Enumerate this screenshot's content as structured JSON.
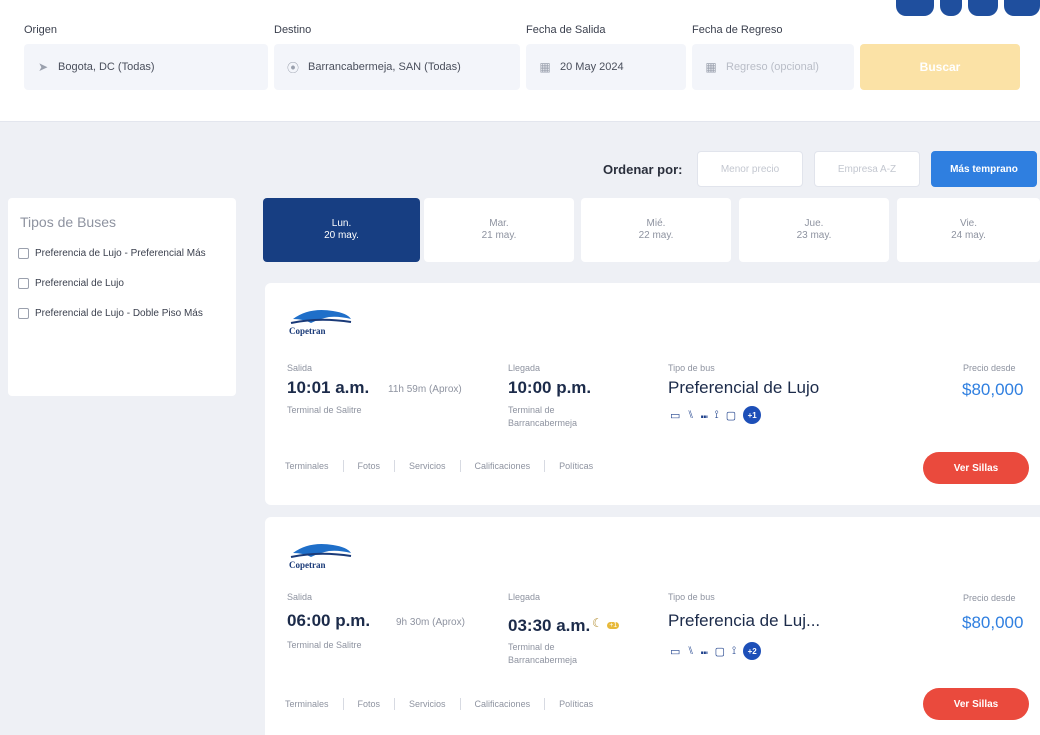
{
  "search": {
    "origin_label": "Origen",
    "origin_value": "Bogota, DC (Todas)",
    "destination_label": "Destino",
    "destination_value": "Barrancabermeja, SAN (Todas)",
    "departure_label": "Fecha de Salida",
    "departure_value": "20 May 2024",
    "return_label": "Fecha de Regreso",
    "return_placeholder": "Regreso (opcional)",
    "search_button": "Buscar"
  },
  "order": {
    "label": "Ordenar por:",
    "options": [
      "Menor precio",
      "Empresa A-Z",
      "Más temprano"
    ],
    "active": "Más temprano"
  },
  "filters": {
    "title": "Tipos de Buses",
    "items": [
      {
        "label": "Preferencia de Lujo - Preferencial Más"
      },
      {
        "label": "Preferencial de Lujo"
      },
      {
        "label": "Preferencial de Lujo - Doble Piso Más"
      }
    ]
  },
  "dates": [
    {
      "day": "Lun.",
      "date": "20 may.",
      "active": true
    },
    {
      "day": "Mar.",
      "date": "21 may.",
      "active": false
    },
    {
      "day": "Mié.",
      "date": "22 may.",
      "active": false
    },
    {
      "day": "Jue.",
      "date": "23 may.",
      "active": false
    },
    {
      "day": "Vie.",
      "date": "24 may.",
      "active": false
    }
  ],
  "trips": [
    {
      "company": "Copetran",
      "departure_label": "Salida",
      "departure_time": "10:01 a.m.",
      "duration": "11h 59m (Aprox)",
      "departure_terminal": "Terminal de Salitre",
      "arrival_label": "Llegada",
      "arrival_time": "10:00 p.m.",
      "arrival_terminal": "Terminal de Barrancabermeja",
      "bus_type_label": "Tipo de bus",
      "bus_type": "Preferencial de Lujo",
      "amenities_more": "+1",
      "price_label": "Precio desde",
      "price": "$80,000",
      "links": [
        "Terminales",
        "Fotos",
        "Servicios",
        "Calificaciones",
        "Políticas"
      ],
      "button": "Ver Sillas"
    },
    {
      "company": "Copetran",
      "departure_label": "Salida",
      "departure_time": "06:00 p.m.",
      "duration": "9h 30m (Aprox)",
      "departure_terminal": "Terminal de Salitre",
      "arrival_label": "Llegada",
      "arrival_time": "03:30 a.m.",
      "arrival_badge": "+1",
      "arrival_terminal": "Terminal de Barrancabermeja",
      "bus_type_label": "Tipo de bus",
      "bus_type": "Preferencia de Luj...",
      "amenities_more": "+2",
      "price_label": "Precio desde",
      "price": "$80,000",
      "links": [
        "Terminales",
        "Fotos",
        "Servicios",
        "Calificaciones",
        "Políticas"
      ],
      "button": "Ver Sillas"
    }
  ],
  "colors": {
    "primary": "#173e82",
    "accent": "#2f7fe0",
    "cta": "#ea4a3d",
    "search_button": "#fbe2a6"
  }
}
